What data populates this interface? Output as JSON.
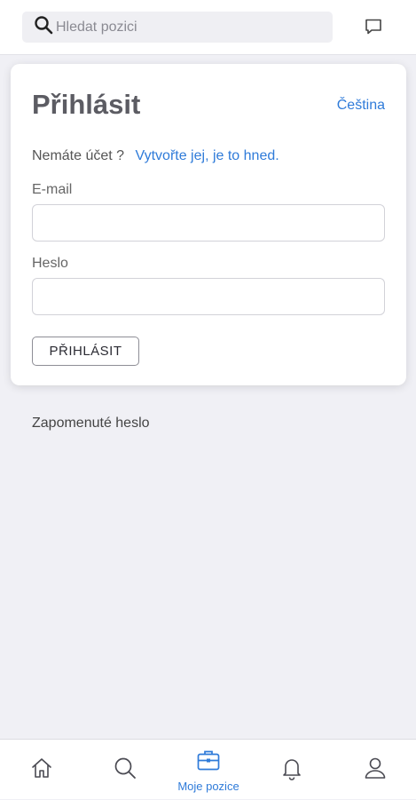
{
  "header": {
    "search_placeholder": "Hledat pozici"
  },
  "login": {
    "title": "Přihlásit",
    "language": "Čeština",
    "no_account_text": "Nemáte účet ?",
    "create_account_link": "Vytvořte jej, je to hned.",
    "email_label": "E-mail",
    "email_value": "",
    "password_label": "Heslo",
    "password_value": "",
    "submit_label": "PŘIHLÁSIT"
  },
  "forgot_password": "Zapomenuté heslo",
  "nav": {
    "items": [
      {
        "icon": "home-icon",
        "label": ""
      },
      {
        "icon": "search-icon",
        "label": ""
      },
      {
        "icon": "briefcase-icon",
        "label": "Moje pozice",
        "active": true
      },
      {
        "icon": "bell-icon",
        "label": ""
      },
      {
        "icon": "user-icon",
        "label": ""
      }
    ]
  },
  "colors": {
    "accent": "#2f7bd9",
    "background": "#f0f0f5",
    "card": "#ffffff",
    "icon": "#4a4a52"
  }
}
